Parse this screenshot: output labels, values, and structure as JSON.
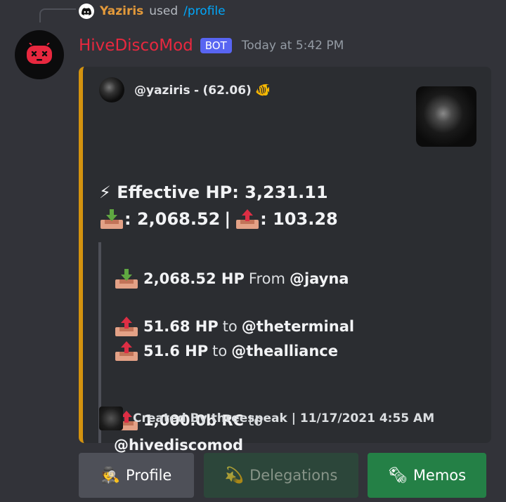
{
  "reply": {
    "user": "Yaziris",
    "verb": "used",
    "command": "/profile"
  },
  "message": {
    "username": "HiveDiscoMod",
    "bot_tag": "BOT",
    "timestamp": "Today at 5:42 PM"
  },
  "embed": {
    "author": {
      "handle": "@yaziris",
      "separator": "-",
      "score": "(62.06)",
      "emoji": "🐠"
    },
    "effective_hp": "⚡ Effective HP: 3,231.11",
    "incoming": ": 2,068.52",
    "divider": "|",
    "outgoing": ": 103.28",
    "delegations_in": [
      {
        "amount": "2,068.52 HP",
        "word": "From",
        "account": "@jayna"
      }
    ],
    "delegations_out": [
      {
        "amount": "51.68 HP",
        "word": "to",
        "account": "@theterminal"
      },
      {
        "amount": "51.6 HP",
        "word": "to",
        "account": "@thealliance"
      }
    ],
    "rc": {
      "amount": "1,000.0b RC",
      "word": "to",
      "account": "@hivediscomod"
    },
    "footer": "Created By threespeak | 11/17/2021 4:55 AM",
    "accent_color": "#d4930f"
  },
  "buttons": [
    {
      "emoji": "🕵",
      "label": "Profile",
      "state": "secondary"
    },
    {
      "emoji": "💫",
      "label": "Delegations",
      "state": "disabled"
    },
    {
      "emoji": "🗞",
      "label": "Memos",
      "state": "success"
    }
  ],
  "icons": [
    "discord-bot-icon",
    "download-tray-icon",
    "upload-tray-icon",
    "lightning-icon"
  ]
}
